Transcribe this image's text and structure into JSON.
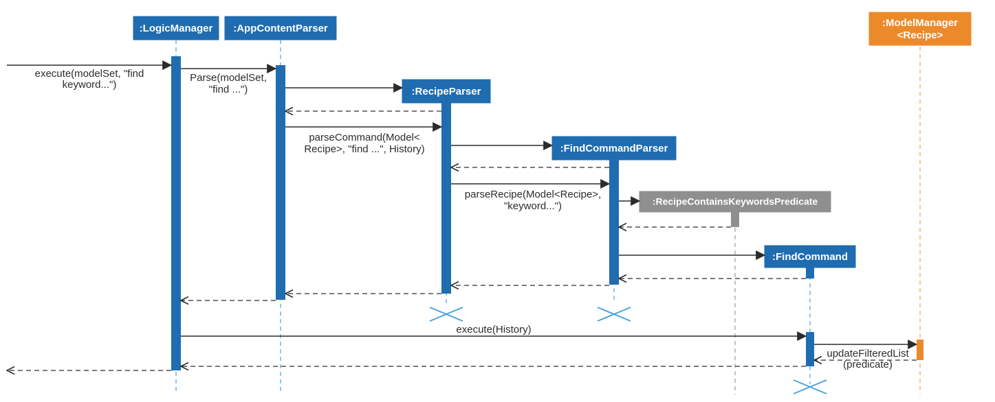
{
  "colors": {
    "blue": "#1f6cb0",
    "orange": "#ec8a2a",
    "grey": "#8f8f8f",
    "lifelineBlue": "#4aa3e0"
  },
  "lifelines": {
    "logicManager": {
      "label": ":LogicManager"
    },
    "appContentParser": {
      "label": ":AppContentParser"
    },
    "recipeParser": {
      "label": ":RecipeParser"
    },
    "findCommandParser": {
      "label": ":FindCommandParser"
    },
    "predicate": {
      "label": ":RecipeContainsKeywordsPredicate"
    },
    "findCommand": {
      "label": ":FindCommand"
    },
    "modelManager": {
      "label1": ":ModelManager",
      "label2": "<Recipe>"
    }
  },
  "messages": {
    "m1a": "execute(modelSet, \"find",
    "m1b": "keyword...\")",
    "m2a": "Parse(modelSet,",
    "m2b": "\"find ...\")",
    "m3a": "parseCommand(Model<",
    "m3b": "Recipe>, \"find ...\", History)",
    "m4a": "parseRecipe(Model<Recipe>,",
    "m4b": "\"keyword...\")",
    "m5": "execute(History)",
    "m6a": "updateFilteredList",
    "m6b": "(predicate)"
  }
}
